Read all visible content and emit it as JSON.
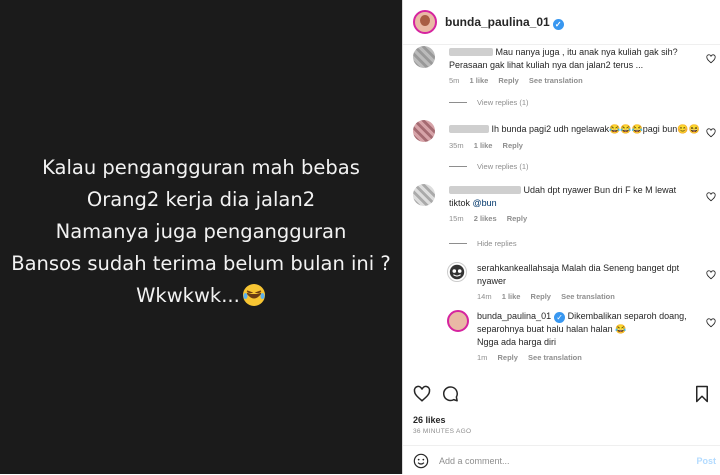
{
  "caption": {
    "lines": [
      "Kalau pengangguran mah bebas",
      "Orang2 kerja dia jalan2",
      "Namanya juga pengangguran",
      "Bansos sudah terima belum bulan ini ?",
      "Wkwkwk..."
    ]
  },
  "header": {
    "username": "bunda_paulina_01",
    "verified": "✓"
  },
  "comments": [
    {
      "name": "",
      "text_1": "Mau nanya juga , itu anak nya kuliah gak sih?",
      "text_2": "Perasaan gak lihat kuliah nya dan jalan2 terus ...",
      "time": "5m",
      "likes": "1 like",
      "reply": "Reply",
      "translate": "See translation"
    },
    {
      "name": "",
      "text_1": "Ih bunda pagi2 udh ngelawak😂😂😂pagi bun😊😆",
      "time": "35m",
      "likes": "1 like",
      "reply": "Reply"
    },
    {
      "name": "",
      "text_1": "Udah dpt nyawer Bun dri F ke M lewat",
      "text_2": "tiktok ",
      "mention": "@bun",
      "time": "15m",
      "likes": "2 likes",
      "reply": "Reply"
    },
    {
      "name": "serahkankeallahsaja",
      "text_1": "Malah dia Seneng banget dpt",
      "text_2": "nyawer",
      "time": "14m",
      "likes": "1 like",
      "reply": "Reply",
      "translate": "See translation"
    },
    {
      "name": "bunda_paulina_01",
      "verified": "✓",
      "text_1": "Dikembalikan separoh doang,",
      "text_2": "separohnya buat halu halan halan 😂",
      "text_3": "Ngga ada harga diri",
      "time": "1m",
      "reply": "Reply",
      "translate": "See translation"
    }
  ],
  "replies_toggles": [
    "View replies (1)",
    "View replies (1)",
    "Hide replies"
  ],
  "actions": {
    "like_icon": "heart-icon",
    "comment_icon": "comment-icon",
    "save_icon": "bookmark-icon"
  },
  "likes": "26 likes",
  "time_ago": "36 MINUTES AGO",
  "add_comment": {
    "placeholder": "Add a comment...",
    "post_label": "Post",
    "emoji_icon": "smiley-icon"
  },
  "colors": {
    "image_bg": "#1b1b1b",
    "link": "#00376b",
    "verified": "#3897f0",
    "meta": "#8e8e8e"
  }
}
